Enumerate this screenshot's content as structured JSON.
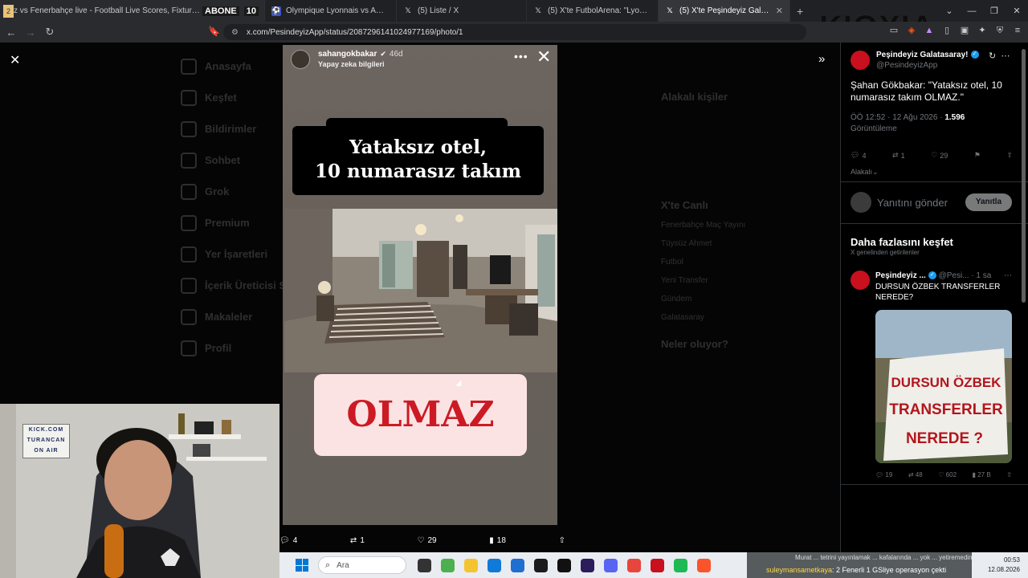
{
  "tabs": [
    {
      "favicon": "2",
      "overlay": "ABONE",
      "title": "z vs Fenerbahçe live - Football Live Scores, Fixtures & Odds",
      "badge": "10"
    },
    {
      "title": "Olympique Lyonnais vs AC Sparta Pra",
      "favicon": "soccer-icon"
    },
    {
      "title": "(5) Liste / X",
      "favicon": "x-logo-icon"
    },
    {
      "title": "(5) X'te FutbolArena: \"Lyon Teknik Dir",
      "favicon": "x-logo-icon"
    },
    {
      "title": "(5) X'te Peşindeyiz Galatasaray!: ",
      "favicon": "x-logo-icon",
      "active": true
    }
  ],
  "overlay_brand": "KIOXIA",
  "address": {
    "url": "x.com/PesindeyizApp/status/2087296141024977169/photo/1"
  },
  "background_nav": [
    "Anasayfa",
    "Keşfet",
    "Bildirimler",
    "Sohbet",
    "Grok",
    "Premium",
    "Yer İşaretleri",
    "İçerik Üreticisi S",
    "Makaleler",
    "Profil"
  ],
  "background_right": {
    "who_to_follow": "Alakalı kişiler",
    "trending": "X'te Canlı",
    "rows": [
      "Fenerbahçe Maç Yayını",
      "Tüysüz Ahmet",
      "Futbol",
      "Yeni Transfer",
      "Gündem",
      "Galatasaray"
    ],
    "whats_happening": "Neler oluyor?"
  },
  "story": {
    "username": "sahangokbakar",
    "age": "46d",
    "subtitle": "Yapay zeka bilgileri",
    "headline_line1": "Yataksız otel,",
    "headline_line2": "10 numarasız takım",
    "answer": "OLMAZ"
  },
  "photo_actions": {
    "replies": "4",
    "reposts": "1",
    "likes": "29",
    "views": "18"
  },
  "tweet": {
    "author": "Peşindeyiz Galatasaray!",
    "handle": "@PesindeyizApp",
    "text": "Şahan Gökbakar: \"Yataksız otel, 10 numarasız takım OLMAZ.\"",
    "time": "ÖÖ 12:52 · 12 Ağu 2026 ·",
    "views_count": "1.596",
    "views_label": "Görüntüleme",
    "replies": "4",
    "reposts": "1",
    "likes": "29",
    "related": "Alakalı"
  },
  "reply": {
    "placeholder": "Yanıtını gönder",
    "button": "Yanıtla"
  },
  "discover": {
    "title": "Daha fazlasını keşfet",
    "subtitle": "X genelinden getirilenler"
  },
  "tweet2": {
    "author": "Peşindeyiz ...",
    "handle": "@Pesi...",
    "time": "· 1 sa",
    "text": "DURSUN ÖZBEK TRANSFERLER NEREDE?",
    "banner_line1": "DURSUN ÖZBEK",
    "banner_line2": "TRANSFERLER",
    "banner_line3": "NEREDE ?",
    "replies": "19",
    "reposts": "48",
    "likes": "602",
    "views": "27 B"
  },
  "webcam": {
    "sign_line1": "KICK.COM",
    "sign_line2": "TURANCAN",
    "sign_line3": "ON AIR"
  },
  "taskbar": {
    "search_placeholder": "Ara",
    "ticker_top": "Murat ... tetrini yayınlamak ... kafalarında ... yok ... yetiremedim ...",
    "ticker_user": "suleymansametkaya",
    "ticker_msg": ": 2 Fenerli 1 GSliye operasyon çekti",
    "clock_time": "00:53",
    "clock_date": "12.08.2026"
  },
  "colors": {
    "accent": "#1d9bf0",
    "verified": "#1d9bf0",
    "brand_red": "#c8101e",
    "olmaz_red": "#cc1a24"
  }
}
